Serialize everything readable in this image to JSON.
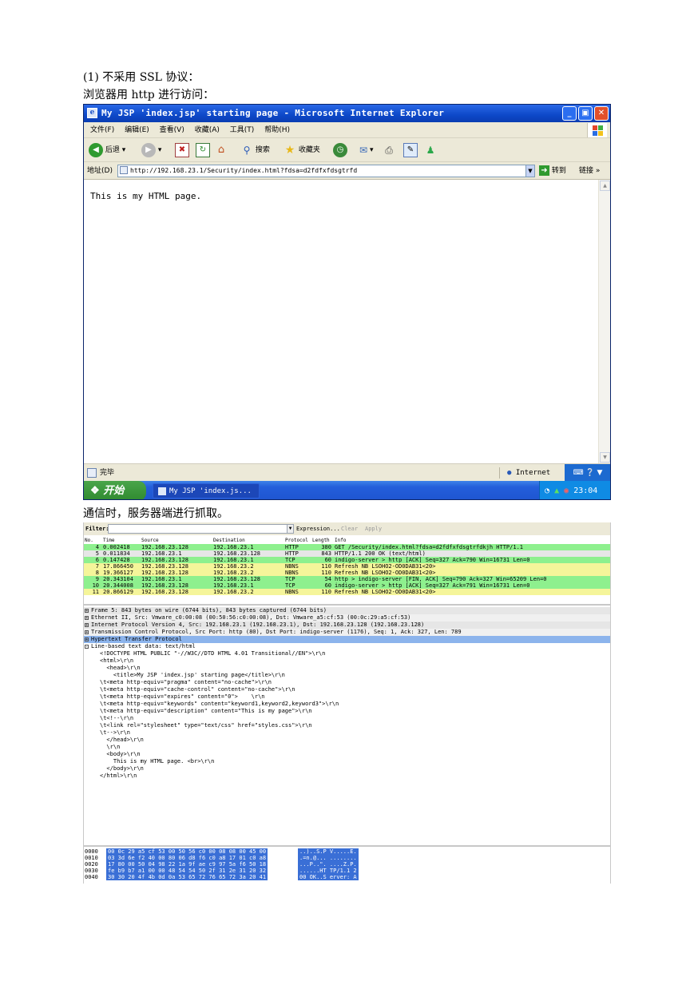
{
  "doc": {
    "heading": "(1)  不采用 SSL 协议：",
    "line2": "浏览器用 http 进行访问：",
    "line3": "通信时，服务器端进行抓取。"
  },
  "ie": {
    "title": "My JSP 'index.jsp' starting page - Microsoft Internet Explorer",
    "menu": [
      "文件(F)",
      "编辑(E)",
      "查看(V)",
      "收藏(A)",
      "工具(T)",
      "帮助(H)"
    ],
    "toolbar": {
      "back": "后退",
      "search": "搜索",
      "favorites": "收藏夹"
    },
    "address_label": "地址(D)",
    "address": "http://192.168.23.1/Security/index.html?fdsa=d2fdfxfdsgtrfd",
    "go": "转到",
    "links": "链接",
    "content_text": "This is my HTML page.",
    "status": "完毕",
    "zone": "Internet",
    "start": "开始",
    "task": "My JSP 'index.js...",
    "clock": "23:04"
  },
  "wireshark": {
    "filter_label": "Filter:",
    "filter_buttons": [
      "Expression...",
      "Clear",
      "Apply"
    ],
    "columns": [
      "No.",
      "Time",
      "Source",
      "Destination",
      "Protocol",
      "Length",
      "Info"
    ],
    "packets": [
      {
        "no": "4",
        "time": "0.002418",
        "src": "192.168.23.128",
        "dst": "192.168.23.1",
        "proto": "HTTP",
        "len": "380",
        "info": "GET /Security/index.html?fdsa=d2fdfxfdsgtrfdkjh HTTP/1.1",
        "color": "#8ef08e"
      },
      {
        "no": "5",
        "time": "0.011834",
        "src": "192.168.23.1",
        "dst": "192.168.23.128",
        "proto": "HTTP",
        "len": "843",
        "info": "HTTP/1.1 200 OK  (text/html)",
        "color": "#e6e6e6"
      },
      {
        "no": "6",
        "time": "0.147428",
        "src": "192.168.23.128",
        "dst": "192.168.23.1",
        "proto": "TCP",
        "len": "60",
        "info": "indigo-server > http [ACK] Seq=327 Ack=790 Win=16731 Len=0",
        "color": "#8ef08e"
      },
      {
        "no": "7",
        "time": "17.866450",
        "src": "192.168.23.128",
        "dst": "192.168.23.2",
        "proto": "NBNS",
        "len": "110",
        "info": "Refresh NB LSOHO2-OD0DAB31<20>",
        "color": "#f5f59a"
      },
      {
        "no": "8",
        "time": "19.366127",
        "src": "192.168.23.128",
        "dst": "192.168.23.2",
        "proto": "NBNS",
        "len": "110",
        "info": "Refresh NB LSOHO2-OD0DAB31<20>",
        "color": "#f5f59a"
      },
      {
        "no": "9",
        "time": "20.343104",
        "src": "192.168.23.1",
        "dst": "192.168.23.128",
        "proto": "TCP",
        "len": "54",
        "info": "http > indigo-server [FIN, ACK] Seq=790 Ack=327 Win=65209 Len=0",
        "color": "#8ef08e"
      },
      {
        "no": "10",
        "time": "20.344008",
        "src": "192.168.23.128",
        "dst": "192.168.23.1",
        "proto": "TCP",
        "len": "60",
        "info": "indigo-server > http [ACK] Seq=327 Ack=791 Win=16731 Len=0",
        "color": "#8ef08e"
      },
      {
        "no": "11",
        "time": "20.866129",
        "src": "192.168.23.128",
        "dst": "192.168.23.2",
        "proto": "NBNS",
        "len": "110",
        "info": "Refresh NB LSOHO2-OD0DAB31<20>",
        "color": "#f5f59a"
      }
    ],
    "tree": [
      {
        "sign": "+",
        "text": "Frame 5: 843 bytes on wire (6744 bits), 843 bytes captured (6744 bits)",
        "hl": false
      },
      {
        "sign": "+",
        "text": "Ethernet II, Src: Vmware_c0:00:08 (00:50:56:c0:00:08), Dst: Vmware_a5:cf:53 (00:0c:29:a5:cf:53)",
        "hl": false
      },
      {
        "sign": "+",
        "text": "Internet Protocol Version 4, Src: 192.168.23.1 (192.168.23.1), Dst: 192.168.23.128 (192.168.23.128)",
        "hl": false
      },
      {
        "sign": "+",
        "text": "Transmission Control Protocol, Src Port: http (80), Dst Port: indigo-server (1176), Seq: 1, Ack: 327, Len: 789",
        "hl": false
      },
      {
        "sign": "+",
        "text": "Hypertext Transfer Protocol",
        "hl": true
      },
      {
        "sign": "-",
        "text": "Line-based text data: text/html",
        "hl": false
      }
    ],
    "source_lines": [
      "<!DOCTYPE HTML PUBLIC \"-//W3C//DTD HTML 4.01 Transitional//EN\">\\r\\n",
      "<html>\\r\\n",
      "  <head>\\r\\n",
      "    <title>My JSP 'index.jsp' starting page</title>\\r\\n",
      "\\t<meta http-equiv=\"pragma\" content=\"no-cache\">\\r\\n",
      "\\t<meta http-equiv=\"cache-control\" content=\"no-cache\">\\r\\n",
      "\\t<meta http-equiv=\"expires\" content=\"0\">    \\r\\n",
      "\\t<meta http-equiv=\"keywords\" content=\"keyword1,keyword2,keyword3\">\\r\\n",
      "\\t<meta http-equiv=\"description\" content=\"This is my page\">\\r\\n",
      "\\t<!--\\r\\n",
      "\\t<link rel=\"stylesheet\" type=\"text/css\" href=\"styles.css\">\\r\\n",
      "\\t-->\\r\\n",
      "  </head>\\r\\n",
      "  \\r\\n",
      "  <body>\\r\\n",
      "    This is my HTML page. <br>\\r\\n",
      "  </body>\\r\\n",
      "</html>\\r\\n"
    ],
    "hex": [
      {
        "off": "0000",
        "bytes": "00 0c 29 a5 cf 53 00 50  56 c0 00 08 08 00 45 00",
        "ascii": "..)..S.P V.....E."
      },
      {
        "off": "0010",
        "bytes": "03 3d 6e f2 40 00 80 06  d8 f6 c0 a8 17 01 c0 a8",
        "ascii": ".=n.@... ........"
      },
      {
        "off": "0020",
        "bytes": "17 80 00 50 04 98 22 1a  9f ae c9 97 5a f6 50 18",
        "ascii": "...P..\". ....Z.P."
      },
      {
        "off": "0030",
        "bytes": "fe b9 b7 a1 00 00 48 54  54 50 2f 31 2e 31 20 32",
        "ascii": "......HT TP/1.1 2"
      },
      {
        "off": "0040",
        "bytes": "30 30 20 4f 4b 0d 0a 53  65 72 76 65 72 3a 20 41",
        "ascii": "00 OK..S erver: A"
      }
    ]
  }
}
